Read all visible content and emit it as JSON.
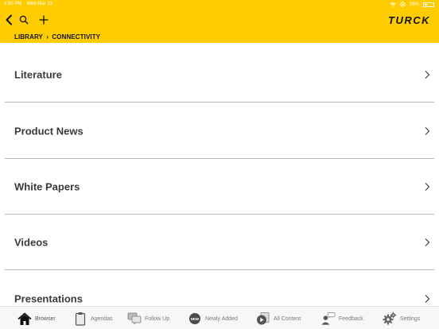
{
  "status": {
    "time": "6:50 PM",
    "date": "Wed Mar 13",
    "battery": "25%"
  },
  "header": {
    "brand": "TURCK",
    "breadcrumb": {
      "root": "LIBRARY",
      "separator": "›",
      "current": "CONNECTIVITY"
    },
    "accent": "#FFCC00"
  },
  "list": {
    "items": [
      {
        "label": "Literature"
      },
      {
        "label": "Product News"
      },
      {
        "label": "White Papers"
      },
      {
        "label": "Videos"
      },
      {
        "label": "Presentations"
      }
    ]
  },
  "tabbar": {
    "tabs": [
      {
        "label": "Browser",
        "icon": "home-icon"
      },
      {
        "label": "Agendas",
        "icon": "clipboard-icon"
      },
      {
        "label": "Follow Up",
        "icon": "chat-bubbles-icon"
      },
      {
        "label": "Newly Added",
        "icon": "new-badge-icon"
      },
      {
        "label": "All Content",
        "icon": "play-content-icon"
      },
      {
        "label": "Feedback",
        "icon": "person-speech-icon"
      },
      {
        "label": "Settings",
        "icon": "gears-icon"
      }
    ]
  }
}
